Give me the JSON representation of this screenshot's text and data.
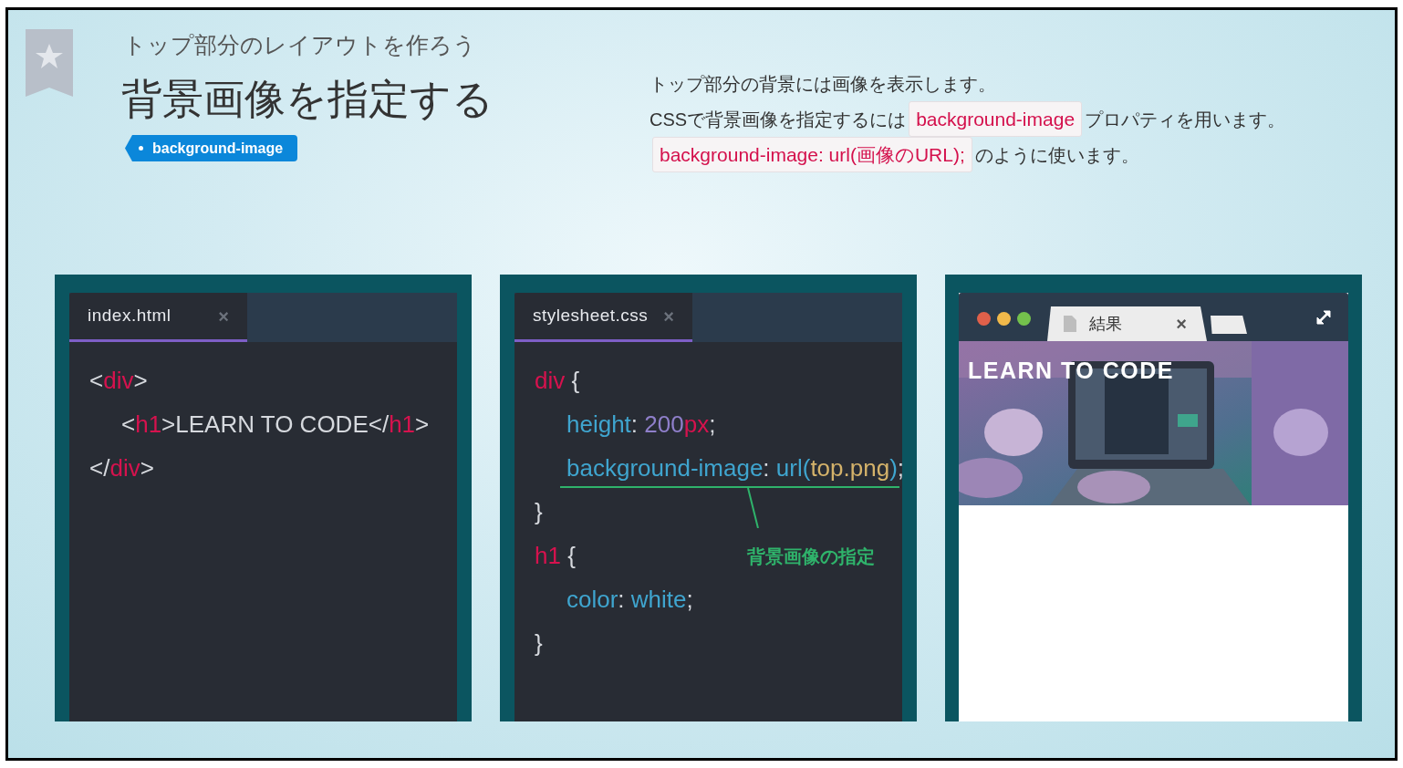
{
  "header": {
    "subtitle": "トップ部分のレイアウトを作ろう",
    "title": "背景画像を指定する",
    "tag": "background-image"
  },
  "description": [
    [
      {
        "t": "トップ部分の背景には画像を表示します。",
        "kind": "text"
      }
    ],
    [
      {
        "t": "CSSで背景画像を指定するには",
        "kind": "text"
      },
      {
        "t": "background-image",
        "kind": "code"
      },
      {
        "t": "プロパティを用います。",
        "kind": "text"
      }
    ],
    [
      {
        "t": "background-image: url(画像のURL);",
        "kind": "code"
      },
      {
        "t": "のように使います。",
        "kind": "text"
      }
    ]
  ],
  "editors": [
    {
      "tab": {
        "label": "index.html",
        "close": "×",
        "selected": true
      },
      "lines": [
        {
          "tokens": [
            {
              "t": "<",
              "kind": "punct"
            },
            {
              "t": "div",
              "kind": "tag"
            },
            {
              "t": ">",
              "kind": "punct"
            }
          ],
          "children": [
            {
              "tokens": [
                {
                  "t": "<",
                  "kind": "punct"
                },
                {
                  "t": "h1",
                  "kind": "tag"
                },
                {
                  "t": ">LEARN TO CODE</",
                  "kind": "punct"
                },
                {
                  "t": "h1",
                  "kind": "tag"
                },
                {
                  "t": ">",
                  "kind": "punct"
                }
              ]
            }
          ]
        },
        {
          "tokens": [
            {
              "t": "</",
              "kind": "punct"
            },
            {
              "t": "div",
              "kind": "tag"
            },
            {
              "t": ">",
              "kind": "punct"
            }
          ]
        }
      ]
    },
    {
      "tab": {
        "label": "stylesheet.css",
        "close": "×",
        "selected": true
      },
      "lines": [
        {
          "tokens": [
            {
              "t": "div",
              "kind": "tag"
            },
            {
              "t": " {",
              "kind": "punct"
            }
          ],
          "children": [
            {
              "tokens": [
                {
                  "t": "height",
                  "kind": "prop"
                },
                {
                  "t": ": ",
                  "kind": "punct"
                },
                {
                  "t": "200",
                  "kind": "number"
                },
                {
                  "t": "px",
                  "kind": "tag"
                },
                {
                  "t": ";",
                  "kind": "punct"
                }
              ]
            },
            {
              "underlined": true,
              "tokens": [
                {
                  "t": "background-image",
                  "kind": "prop"
                },
                {
                  "t": ": ",
                  "kind": "punct"
                },
                {
                  "t": "url(",
                  "kind": "prop"
                },
                {
                  "t": "top.png",
                  "kind": "string"
                },
                {
                  "t": ")",
                  "kind": "prop"
                },
                {
                  "t": ";",
                  "kind": "punct"
                }
              ]
            }
          ]
        },
        {
          "tokens": [
            {
              "t": "}",
              "kind": "punct"
            }
          ]
        },
        {
          "tokens": [
            {
              "t": "h1",
              "kind": "tag"
            },
            {
              "t": " {",
              "kind": "punct"
            }
          ],
          "children": [
            {
              "tokens": [
                {
                  "t": "color",
                  "kind": "prop"
                },
                {
                  "t": ": ",
                  "kind": "punct"
                },
                {
                  "t": "white",
                  "kind": "prop"
                },
                {
                  "t": ";",
                  "kind": "punct"
                }
              ]
            }
          ]
        },
        {
          "tokens": [
            {
              "t": "}",
              "kind": "punct"
            }
          ]
        }
      ],
      "annotation": "背景画像の指定"
    }
  ],
  "browser": {
    "tab": {
      "label": "結果",
      "close": "×"
    },
    "heading": "LEARN TO CODE"
  }
}
